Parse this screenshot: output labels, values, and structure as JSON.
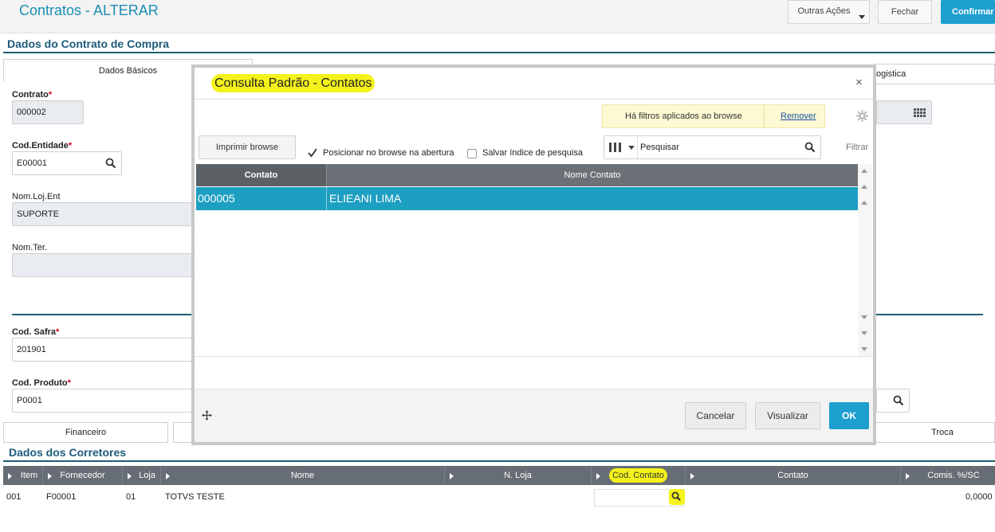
{
  "header": {
    "title": "Contratos - ALTERAR",
    "buttons": {
      "more_actions": "Outras Ações",
      "close": "Fechar",
      "confirm": "Confirmar"
    }
  },
  "section1": {
    "title": "Dados do Contrato de Compra"
  },
  "tabs_top": {
    "dados_basicos": "Dados Básicos",
    "logistica": "ogistica"
  },
  "fields": {
    "contrato": {
      "label": "Contrato",
      "value": "000002"
    },
    "cod_entidade": {
      "label": "Cod.Entidade",
      "value": "E00001"
    },
    "nom_loj_ent": {
      "label": "Nom.Loj.Ent",
      "value": "SUPORTE"
    },
    "nom_ter": {
      "label": "Nom.Ter.",
      "value": ""
    },
    "cod_safra": {
      "label": "Cod. Safra",
      "value": "201901"
    },
    "cod_produto": {
      "label": "Cod. Produto",
      "value": "P0001"
    },
    "required_mark": "*"
  },
  "tabs_bottom": {
    "financeiro": "Financeiro",
    "troca": "Troca"
  },
  "section2": {
    "title": "Dados dos Corretores"
  },
  "grid": {
    "columns": [
      "Item",
      "Fornecedor",
      "Loja",
      "Nome",
      "N. Loja",
      "Cod. Contato",
      "Contato",
      "Comis. %/SC"
    ],
    "rows": [
      {
        "item": "001",
        "fornecedor": "F00001",
        "loja": "01",
        "nome": "TOTVS TESTE",
        "comis": "0,0000"
      }
    ]
  },
  "dialog": {
    "title": "Consulta Padrão - Contatos",
    "close_symbol": "×",
    "filter_info": "Há filtros aplicados ao browse",
    "filter_remove": "Remover",
    "print_button": "Imprimir browse",
    "checkbox_position": {
      "label": "Posicionar no browse na abertura",
      "checked": true
    },
    "checkbox_save_index": {
      "label": "Salvar índice de pesquisa",
      "checked": false
    },
    "search_placeholder": "Pesquisar",
    "filter_label": "Filtrar",
    "columns": [
      "Contato",
      "Nome Contato"
    ],
    "rows": [
      {
        "contato": "000005",
        "nome": "ELIEANI LIMA",
        "selected": true
      }
    ],
    "buttons": {
      "cancel": "Cancelar",
      "view": "Visualizar",
      "ok": "OK"
    }
  },
  "colors": {
    "accent": "#1d9fd0",
    "selected_row": "#1d9fc2",
    "highlight": "#f4f21a",
    "grid_header": "#676d74"
  }
}
